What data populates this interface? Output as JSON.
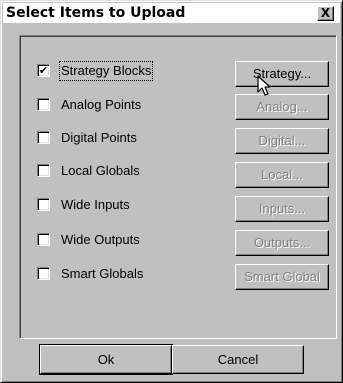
{
  "dialog": {
    "title": "Select Items to Upload",
    "close_label": "X"
  },
  "items": [
    {
      "label": "Strategy Blocks",
      "checked": true,
      "button": "Strategy...",
      "button_enabled": true
    },
    {
      "label": "Analog Points",
      "checked": false,
      "button": "Analog...",
      "button_enabled": false
    },
    {
      "label": "Digital Points",
      "checked": false,
      "button": "Digital...",
      "button_enabled": false
    },
    {
      "label": "Local Globals",
      "checked": false,
      "button": "Local...",
      "button_enabled": false
    },
    {
      "label": "Wide Inputs",
      "checked": false,
      "button": "Inputs...",
      "button_enabled": false
    },
    {
      "label": "Wide Outputs",
      "checked": false,
      "button": "Outputs...",
      "button_enabled": false
    },
    {
      "label": "Smart Globals",
      "checked": false,
      "button": "Smart Global",
      "button_enabled": false
    }
  ],
  "footer": {
    "ok_label": "Ok",
    "cancel_label": "Cancel"
  }
}
